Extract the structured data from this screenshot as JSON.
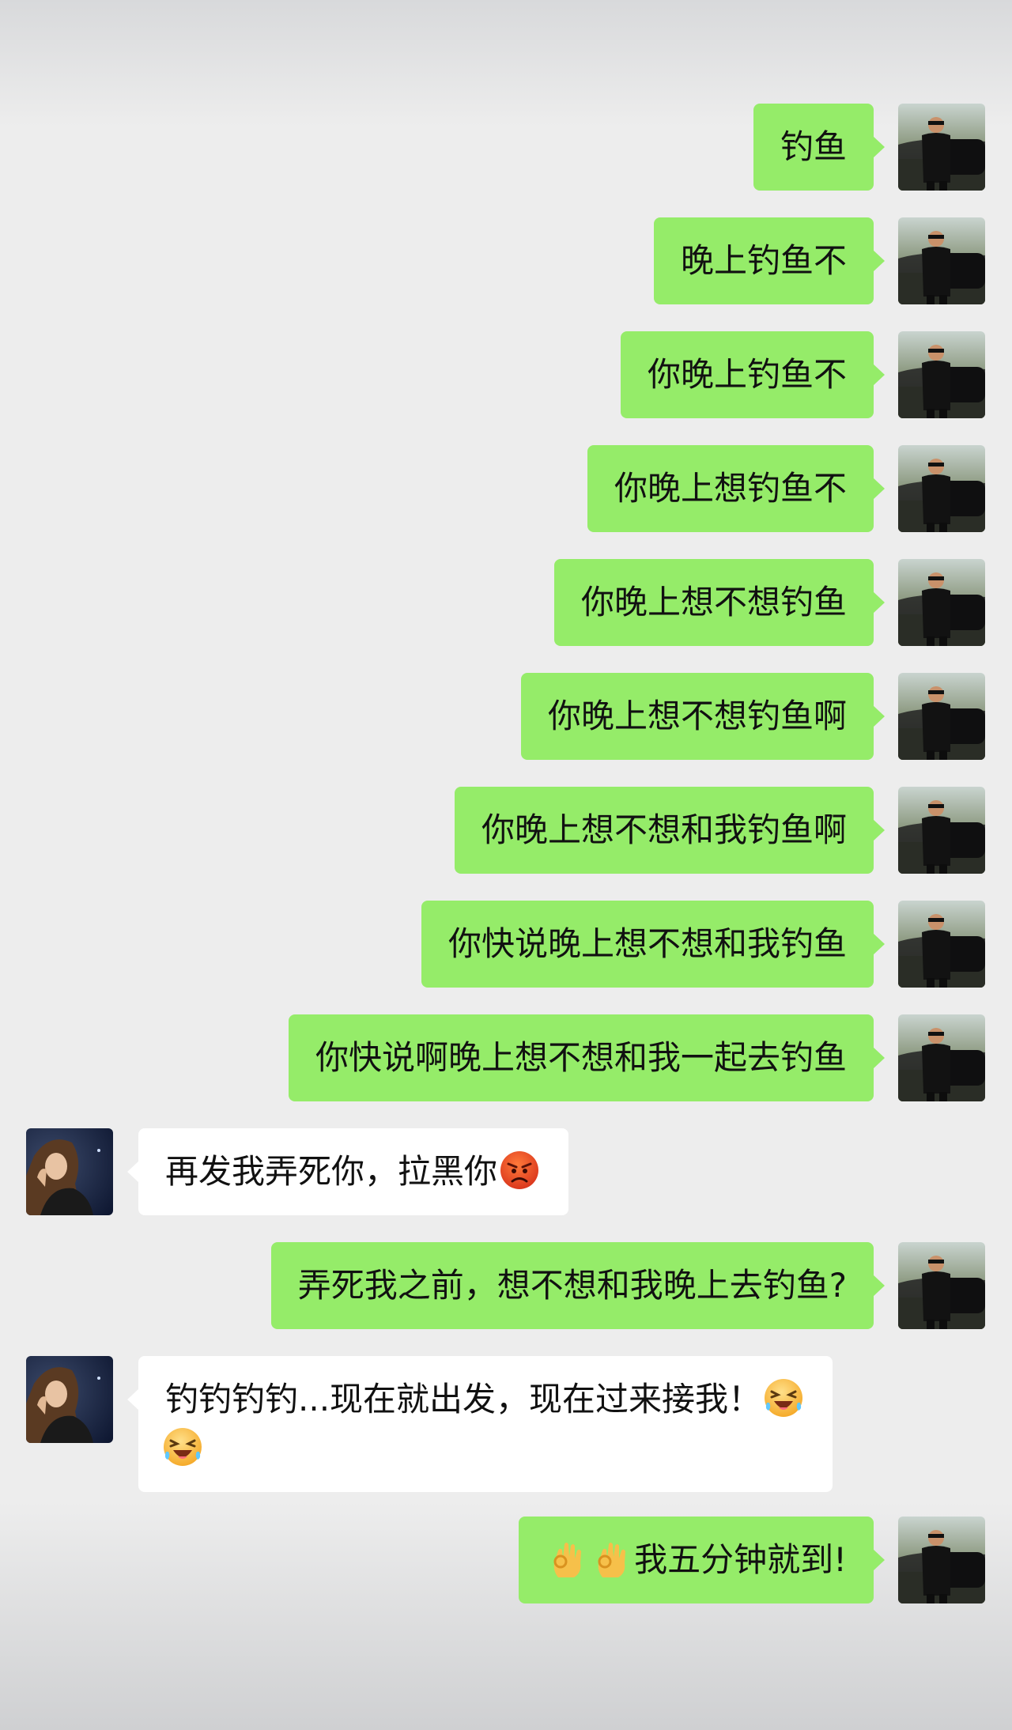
{
  "chat": {
    "messages": [
      {
        "from": "me",
        "text": "钓鱼"
      },
      {
        "from": "me",
        "text": "晚上钓鱼不"
      },
      {
        "from": "me",
        "text": "你晚上钓鱼不"
      },
      {
        "from": "me",
        "text": "你晚上想钓鱼不"
      },
      {
        "from": "me",
        "text": "你晚上想不想钓鱼"
      },
      {
        "from": "me",
        "text": "你晚上想不想钓鱼啊"
      },
      {
        "from": "me",
        "text": "你晚上想不想和我钓鱼啊"
      },
      {
        "from": "me",
        "text": "你快说晚上想不想和我钓鱼"
      },
      {
        "from": "me",
        "text": "你快说啊晚上想不想和我一起去钓鱼"
      },
      {
        "from": "other",
        "text": "再发我弄死你，拉黑你",
        "emoji_after": "angry-face-icon"
      },
      {
        "from": "me",
        "text": "弄死我之前，想不想和我晚上去钓鱼?"
      },
      {
        "from": "other",
        "text": "钓钓钓钓...现在就出发，现在过来接我！",
        "emoji_after": "laughing-squint-icon",
        "emoji_line2": "laughing-squint-icon"
      },
      {
        "from": "me",
        "text": "我五分钟就到!",
        "emoji_before": [
          "ok-hand-icon",
          "ok-hand-icon"
        ]
      }
    ]
  },
  "colors": {
    "my_bubble": "#95ec69",
    "their_bubble": "#ffffff",
    "background": "#ededed"
  }
}
